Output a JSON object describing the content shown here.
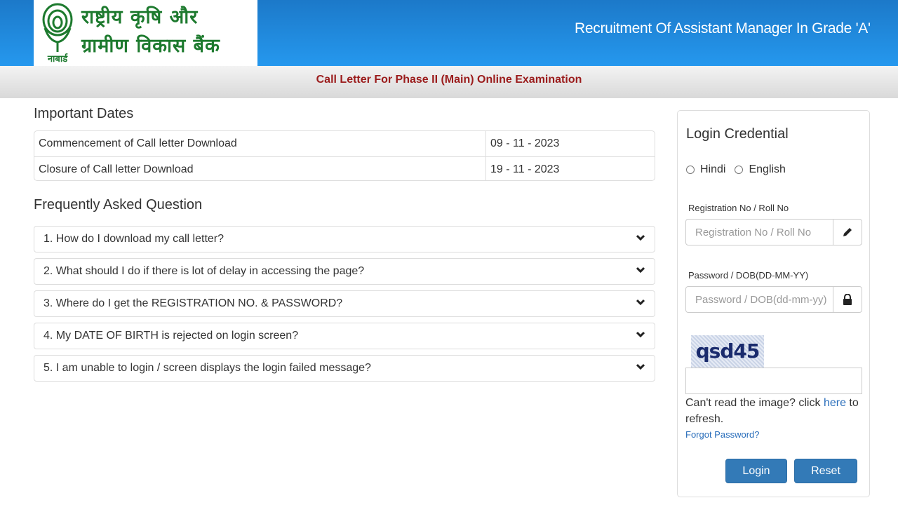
{
  "header": {
    "logo_hindi_line1": "राष्ट्रीय कृषि और",
    "logo_hindi_line2": "ग्रामीण विकास बैंक",
    "logo_emblem_caption": "नाबार्ड",
    "title": "Recruitment Of Assistant Manager In Grade 'A'"
  },
  "subbar": {
    "title": "Call Letter For Phase II (Main) Online Examination"
  },
  "important_dates": {
    "heading": "Important Dates",
    "rows": [
      {
        "label": "Commencement of Call letter Download",
        "value": "09 - 11 - 2023"
      },
      {
        "label": "Closure of Call letter Download",
        "value": "19 - 11 - 2023"
      }
    ]
  },
  "faq": {
    "heading": "Frequently Asked Question",
    "items": [
      {
        "question": "1. How do I download my call letter?"
      },
      {
        "question": "2. What should I do if there is lot of delay in accessing the page?"
      },
      {
        "question": "3. Where do I get the REGISTRATION NO. & PASSWORD?"
      },
      {
        "question": "4. My DATE OF BIRTH is rejected on login screen?"
      },
      {
        "question": "5. I am unable to login / screen displays the login failed message?"
      }
    ]
  },
  "login": {
    "title": "Login Credential",
    "languages": [
      "Hindi",
      "English"
    ],
    "registration": {
      "label": "Registration No / Roll No",
      "placeholder": "Registration No / Roll No",
      "value": ""
    },
    "password": {
      "label": "Password / DOB(DD-MM-YY)",
      "placeholder": "Password / DOB(dd-mm-yy)",
      "value": ""
    },
    "captcha_text": "qsd45",
    "captcha_value": "",
    "refresh_prefix": "Can't read the image? click ",
    "refresh_link": "here",
    "refresh_suffix": " to refresh.",
    "forgot_password": "Forgot Password?",
    "login_button": "Login",
    "reset_button": "Reset"
  }
}
